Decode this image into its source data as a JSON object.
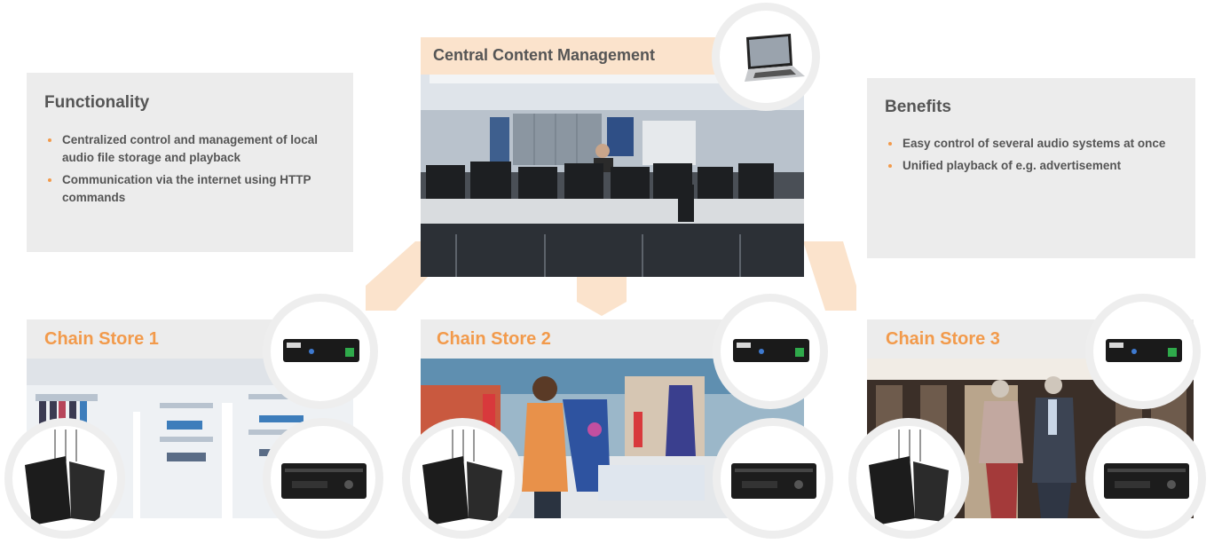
{
  "colors": {
    "accent": "#f29a4b",
    "accent_light": "#fbe3cc",
    "box_bg": "#ececec",
    "text": "#555555"
  },
  "functionality": {
    "title": "Functionality",
    "items": [
      "Centralized control and management of local audio file storage and playback",
      "Communication via the internet using HTTP commands"
    ]
  },
  "benefits": {
    "title": "Benefits",
    "items": [
      "Easy control of several audio systems at once",
      "Unified playback of e.g. advertisement"
    ]
  },
  "central": {
    "title": "Central Content Management",
    "icon": "laptop-icon",
    "image": "control-room-photo"
  },
  "stores": [
    {
      "title": "Chain Store 1",
      "image": "white-boutique-photo"
    },
    {
      "title": "Chain Store 2",
      "image": "shopping-woman-photo"
    },
    {
      "title": "Chain Store 3",
      "image": "menswear-store-photo"
    }
  ],
  "device_icons": [
    "network-audio-module-icon",
    "speaker-pair-icon",
    "amplifier-icon"
  ]
}
